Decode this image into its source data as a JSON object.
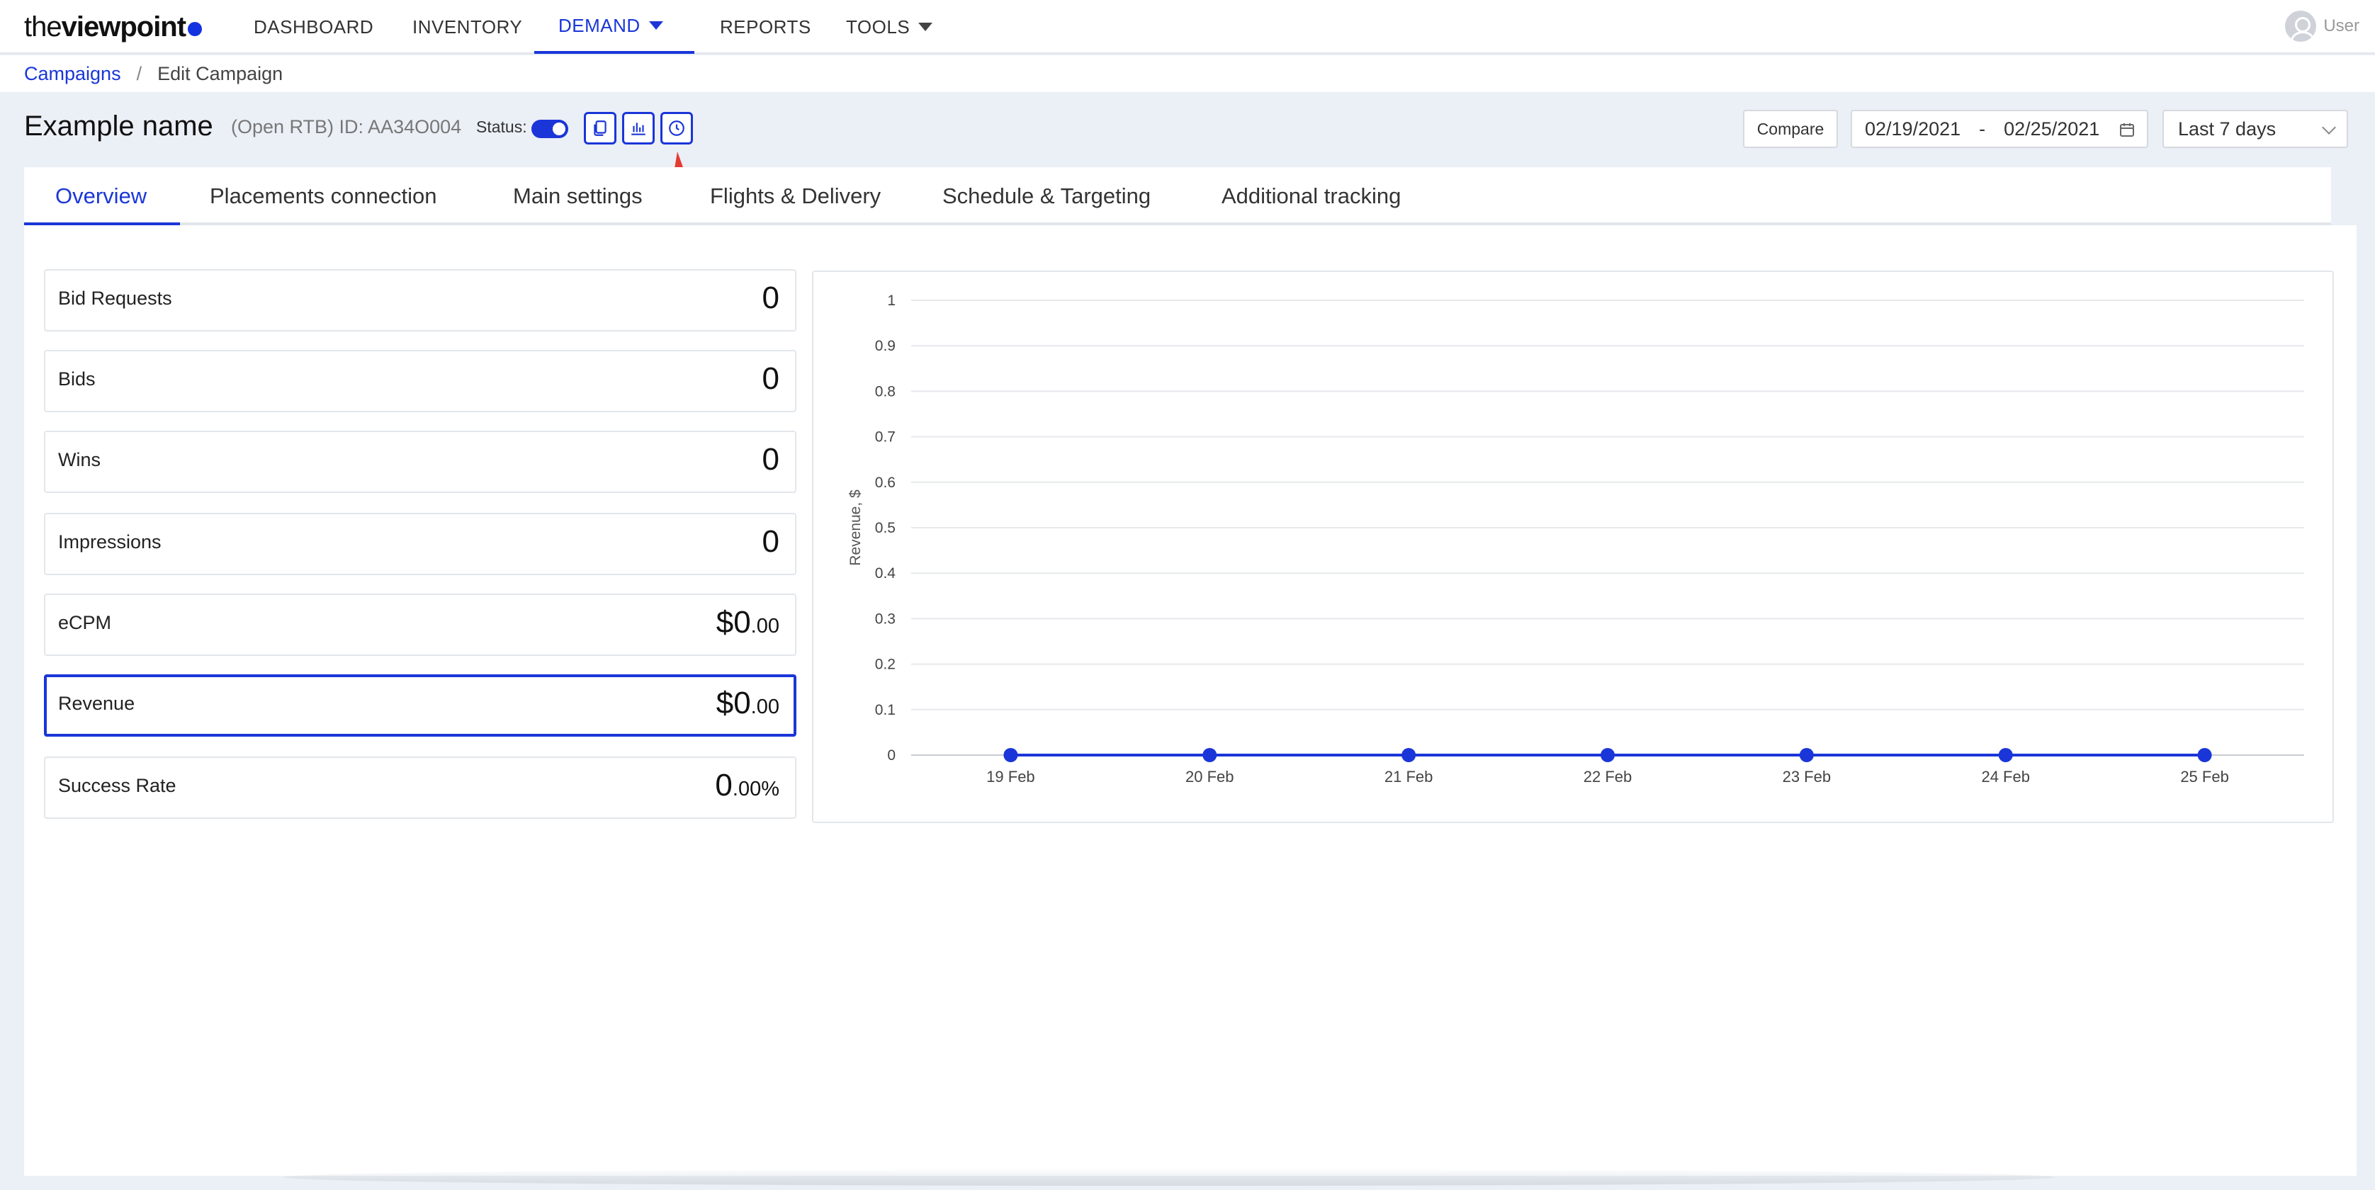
{
  "brand": {
    "logo_thin": "the",
    "logo_bold": "viewpoint"
  },
  "nav": {
    "items": [
      {
        "label": "DASHBOARD"
      },
      {
        "label": "INVENTORY"
      },
      {
        "label": "DEMAND"
      },
      {
        "label": "REPORTS"
      },
      {
        "label": "TOOLS"
      }
    ],
    "user_label": "User"
  },
  "breadcrumb": {
    "parent": "Campaigns",
    "separator": "/",
    "current": "Edit Campaign"
  },
  "header": {
    "title": "Example name",
    "sub_id": "(Open RTB) ID: AA34O004",
    "status_label": "Status:",
    "compare_label": "Compare",
    "date_from": "02/19/2021",
    "date_sep": "-",
    "date_to": "02/25/2021",
    "range_label": "Last 7 days"
  },
  "tabs": [
    {
      "label": "Overview"
    },
    {
      "label": "Placements connection"
    },
    {
      "label": "Main settings"
    },
    {
      "label": "Flights & Delivery"
    },
    {
      "label": "Schedule & Targeting"
    },
    {
      "label": "Additional tracking"
    }
  ],
  "metrics": [
    {
      "label": "Bid Requests",
      "value": "0",
      "value_small": ""
    },
    {
      "label": "Bids",
      "value": "0",
      "value_small": ""
    },
    {
      "label": "Wins",
      "value": "0",
      "value_small": ""
    },
    {
      "label": "Impressions",
      "value": "0",
      "value_small": ""
    },
    {
      "label": "eCPM",
      "value": "$0",
      "value_small": ".00"
    },
    {
      "label": "Revenue",
      "value": "$0",
      "value_small": ".00"
    },
    {
      "label": "Success Rate",
      "value": "0",
      "value_small": ".00%"
    }
  ],
  "icons": {
    "copy": "copy-icon",
    "chart": "bar-chart-icon",
    "history": "clock-icon",
    "calendar": "calendar-icon"
  },
  "colors": {
    "accent": "#1a36d8",
    "annotation_arrow": "#e53a2f"
  },
  "chart_data": {
    "type": "line",
    "categories": [
      "19 Feb",
      "20 Feb",
      "21 Feb",
      "22 Feb",
      "23 Feb",
      "24 Feb",
      "25 Feb"
    ],
    "values": [
      0,
      0,
      0,
      0,
      0,
      0,
      0
    ],
    "ylabel": "Revenue, $",
    "xlabel": "",
    "ylim": [
      0,
      1
    ],
    "yticks": [
      "0",
      "0.1",
      "0.2",
      "0.3",
      "0.4",
      "0.5",
      "0.6",
      "0.7",
      "0.8",
      "0.9",
      "1"
    ],
    "grid": true,
    "color": "#1a36d8"
  }
}
